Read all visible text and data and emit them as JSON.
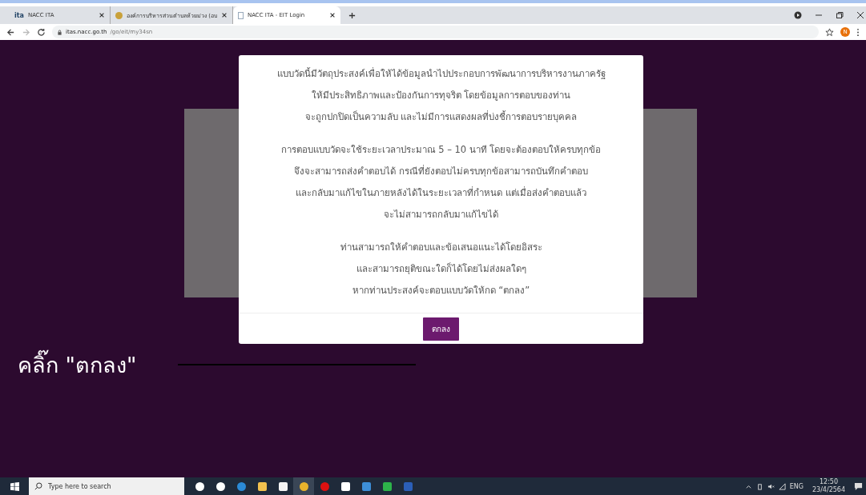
{
  "browser": {
    "tabs": [
      {
        "title": "NACC ITA",
        "favicon_text": "ita",
        "selected": false
      },
      {
        "title": "องค์การบริหารส่วนตำบลห้วยม่วง (อบ",
        "selected": false
      },
      {
        "title": "NACC ITA - EIT Login",
        "selected": true
      }
    ],
    "url_host": "itas.nacc.go.th",
    "url_path": "/go/eit/my34sn",
    "profile_initial": "N"
  },
  "modal": {
    "paragraphs": [
      [
        "แบบวัดนี้มีวัตถุประสงค์เพื่อให้ได้ข้อมูลนำไปประกอบการพัฒนาการบริหารงานภาครัฐ",
        "ให้มีประสิทธิภาพและป้องกันการทุจริต โดยข้อมูลการตอบของท่าน",
        "จะถูกปกปิดเป็นความลับ และไม่มีการแสดงผลที่บ่งชี้การตอบรายบุคคล"
      ],
      [
        "การตอบแบบวัดจะใช้ระยะเวลาประมาณ 5 – 10 นาที โดยจะต้องตอบให้ครบทุกข้อ",
        "จึงจะสามารถส่งคำตอบได้ กรณีที่ยังตอบไม่ครบทุกข้อสามารถบันทึกคำตอบ",
        "และกลับมาแก้ไขในภายหลังได้ในระยะเวลาที่กำหนด แต่เมื่อส่งคำตอบแล้ว",
        "จะไม่สามารถกลับมาแก้ไขได้"
      ],
      [
        "ท่านสามารถให้คำตอบและข้อเสนอแนะได้โดยอิสระ",
        "และสามารถยุติขณะใดก็ได้โดยไม่ส่งผลใดๆ",
        "หากท่านประสงค์จะตอบแบบวัดให้กด “ตกลง”"
      ]
    ],
    "ok_button": "ตกลง"
  },
  "annotation": "คลิ๊ก \"ตกลง\"",
  "taskbar": {
    "search_placeholder": "Type here to search",
    "language": "ENG",
    "time": "12:50",
    "date": "23/4/2564"
  }
}
